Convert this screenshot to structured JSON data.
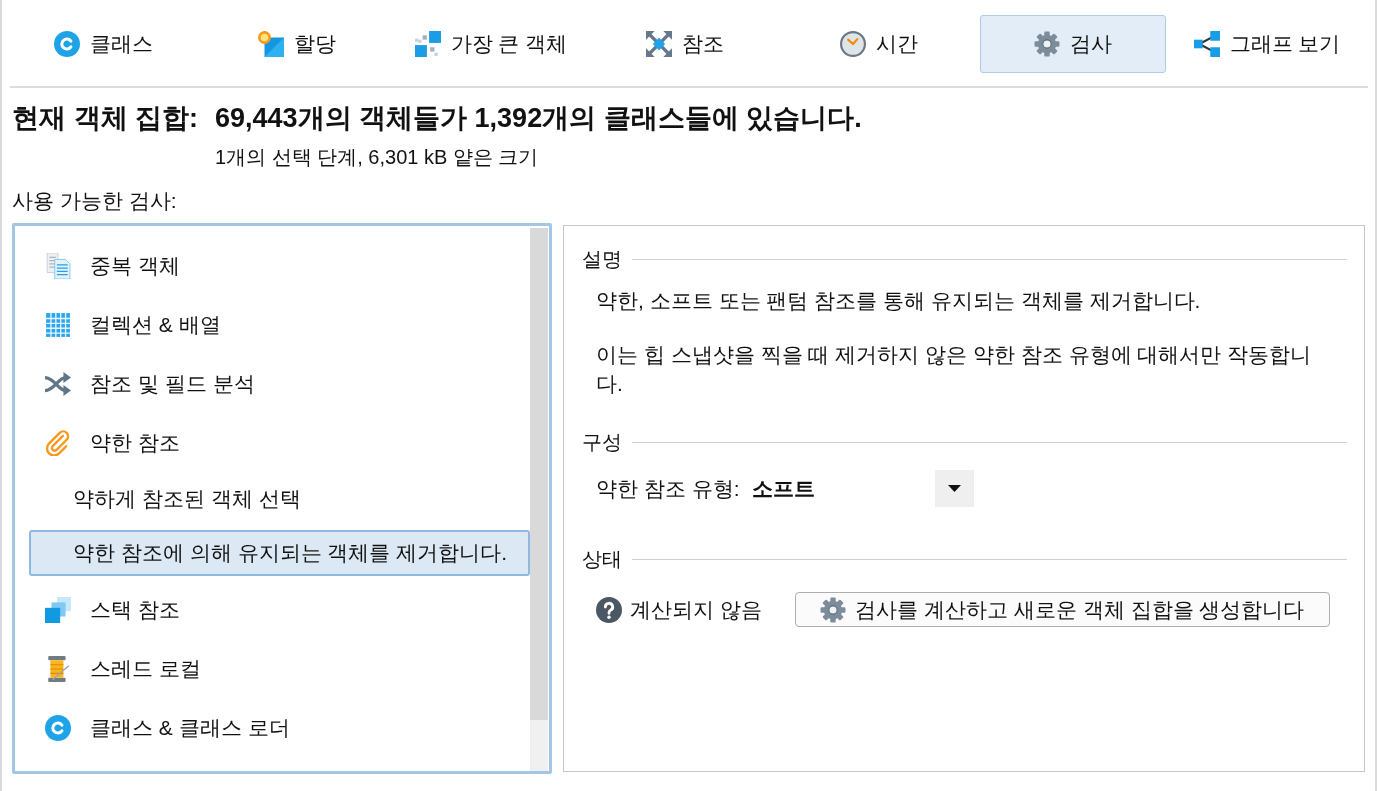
{
  "tabs": [
    {
      "label": "클래스",
      "selected": false
    },
    {
      "label": "할당",
      "selected": false
    },
    {
      "label": "가장 큰 객체",
      "selected": false
    },
    {
      "label": "참조",
      "selected": false
    },
    {
      "label": "시간",
      "selected": false
    },
    {
      "label": "검사",
      "selected": true
    },
    {
      "label": "그래프 보기",
      "selected": false
    }
  ],
  "header": {
    "label": "현재 객체 집합:",
    "summary": "69,443개의 객체들가 1,392개의 클래스들에 있습니다.",
    "detail": "1개의 선택 단계, 6,301 kB 얕은 크기"
  },
  "inspections": {
    "label": "사용 가능한 검사:",
    "items": [
      {
        "label": "중복 객체",
        "selected": false
      },
      {
        "label": "컬렉션 & 배열",
        "selected": false
      },
      {
        "label": "참조 및 필드 분석",
        "selected": false
      },
      {
        "label": "약한 참조",
        "selected": false,
        "children": [
          {
            "label": "약하게 참조된 객체 선택",
            "selected": false
          },
          {
            "label": "약한 참조에 의해 유지되는 객체를 제거합니다.",
            "selected": true
          }
        ]
      },
      {
        "label": "스택 참조",
        "selected": false
      },
      {
        "label": "스레드 로컬",
        "selected": false
      },
      {
        "label": "클래스 & 클래스 로더",
        "selected": false
      }
    ]
  },
  "details": {
    "sections": [
      {
        "kind": "description",
        "title": "설명",
        "paragraphs": [
          "약한, 소프트 또는 팬텀 참조를 통해 유지되는 객체를 제거합니다.",
          "이는 힙 스냅샷을 찍을 때 제거하지 않은 약한 참조 유형에 대해서만 작동합니다."
        ]
      },
      {
        "kind": "config",
        "title": "구성",
        "fields": [
          {
            "label": "약한 참조 유형:",
            "value": "소프트"
          }
        ]
      },
      {
        "kind": "status",
        "title": "상태",
        "status": "계산되지 않음",
        "button": "검사를 계산하고 새로운 객체 집합을 생성합니다"
      }
    ]
  }
}
